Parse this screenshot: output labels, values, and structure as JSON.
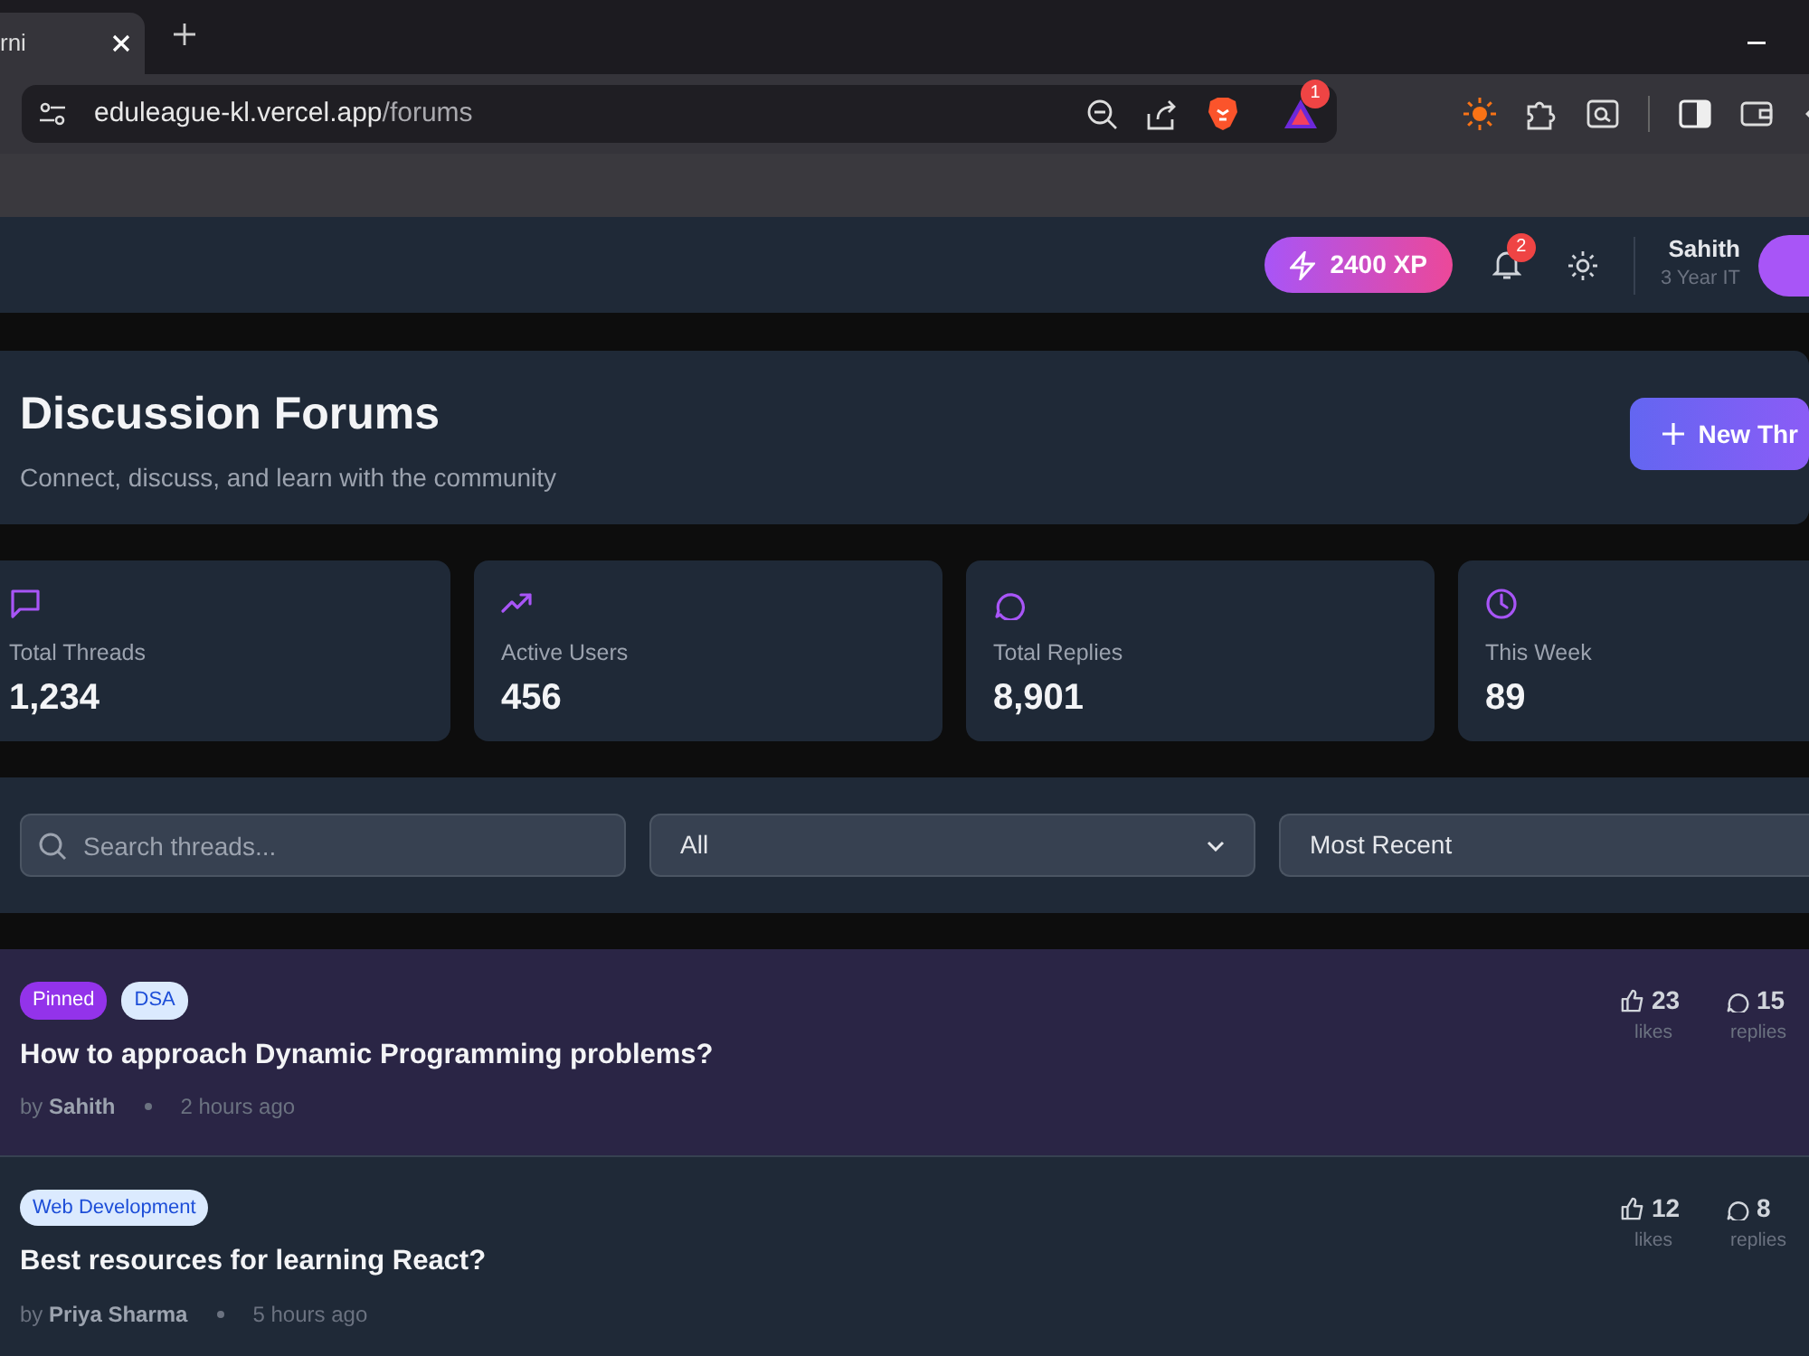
{
  "browser": {
    "tab_title": "rni",
    "url_host": "eduleague-kl.vercel.app",
    "url_path": "/forums",
    "extension_badge": "1"
  },
  "header": {
    "xp": "2400 XP",
    "notifications": "2",
    "user_name": "Sahith",
    "user_subtitle": "3 Year IT"
  },
  "hero": {
    "title": "Discussion Forums",
    "subtitle": "Connect, discuss, and learn with the community",
    "button": "New Thr"
  },
  "stats": [
    {
      "kind": "threads",
      "label": "Total Threads",
      "value": "1,234"
    },
    {
      "kind": "users",
      "label": "Active Users",
      "value": "456"
    },
    {
      "kind": "replies",
      "label": "Total Replies",
      "value": "8,901"
    },
    {
      "kind": "week",
      "label": "This Week",
      "value": "89"
    }
  ],
  "filters": {
    "search_placeholder": "Search threads...",
    "category": "All",
    "sort": "Most Recent"
  },
  "threads": [
    {
      "pinned": true,
      "tags": [
        {
          "kind": "pinned",
          "label": "Pinned"
        },
        {
          "kind": "category",
          "label": "DSA"
        }
      ],
      "title": "How to approach Dynamic Programming problems?",
      "byline": "by **Sahith**",
      "time": "2 hours ago",
      "likes": "23",
      "likes_label": "likes",
      "replies": "15",
      "replies_label": "replies"
    },
    {
      "pinned": false,
      "tags": [
        {
          "kind": "category",
          "label": "Web Development"
        }
      ],
      "title": "Best resources for learning React?",
      "byline": "by **Priya Sharma**",
      "time": "5 hours ago",
      "likes": "12",
      "likes_label": "likes",
      "replies": "8",
      "replies_label": "replies"
    }
  ]
}
